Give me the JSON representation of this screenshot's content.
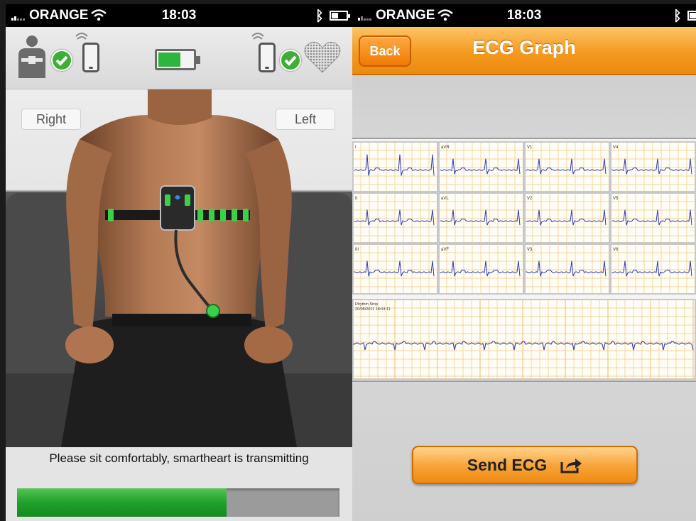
{
  "status_bar": {
    "left": {
      "carrier": "ORANGE",
      "time": "18:03"
    },
    "right": {
      "carrier": "ORANGE",
      "time": "18:03"
    }
  },
  "monitor_screen": {
    "connection_icons": [
      "person-with-device-icon",
      "check-icon",
      "phone-icon",
      "battery-icon",
      "phone-icon",
      "check-icon",
      "heart-icon"
    ],
    "battery_level": 0.62,
    "labels": {
      "right": "Right",
      "left": "Left"
    },
    "instruction": "Please sit comfortably, smartheart is transmitting",
    "transmission_progress": 0.65
  },
  "ecg_screen": {
    "back_label": "Back",
    "title": "ECG Graph",
    "leads": [
      "I",
      "aVR",
      "V1",
      "V4",
      "II",
      "aVL",
      "V2",
      "V5",
      "III",
      "aVF",
      "V3",
      "V6"
    ],
    "rhythm_strip_label": "Rhythm Strip",
    "rhythm_strip_timestamp": "20/05/2011 18:03:11",
    "send_label": "Send ECG",
    "send_icon": "share-icon"
  },
  "colors": {
    "accent_orange": "#F49A1F",
    "progress_green": "#1FA12B",
    "check_green": "#3FAE38",
    "ecg_grid": "#F2C77E",
    "ecg_trace": "#2A3BB8"
  }
}
